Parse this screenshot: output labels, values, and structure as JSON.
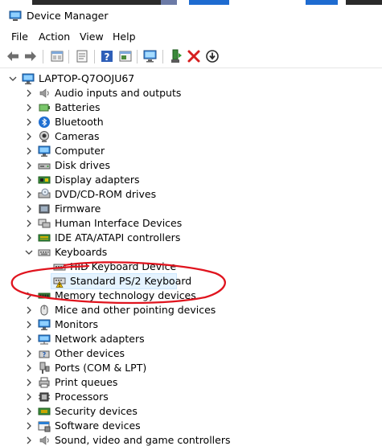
{
  "window": {
    "title": "Device Manager"
  },
  "menu": [
    {
      "label": "File"
    },
    {
      "label": "Action"
    },
    {
      "label": "View"
    },
    {
      "label": "Help"
    }
  ],
  "toolbar": {
    "buttons": [
      "back-icon",
      "forward-icon",
      "properties-sheet-icon",
      "show-hidden-icon",
      "help-icon",
      "action-pane-icon",
      "scan-monitor-icon",
      "update-driver-icon",
      "uninstall-icon",
      "disable-device-icon"
    ]
  },
  "tree": {
    "root": "LAPTOP-Q7OOJU67",
    "categories": [
      {
        "label": "Audio inputs and outputs",
        "icon": "speaker-icon",
        "expanded": false
      },
      {
        "label": "Batteries",
        "icon": "battery-icon",
        "expanded": false
      },
      {
        "label": "Bluetooth",
        "icon": "bluetooth-icon",
        "expanded": false
      },
      {
        "label": "Cameras",
        "icon": "camera-icon",
        "expanded": false
      },
      {
        "label": "Computer",
        "icon": "computer-icon",
        "expanded": false
      },
      {
        "label": "Disk drives",
        "icon": "disk-drive-icon",
        "expanded": false
      },
      {
        "label": "Display adapters",
        "icon": "display-adapter-icon",
        "expanded": false
      },
      {
        "label": "DVD/CD-ROM drives",
        "icon": "dvd-drive-icon",
        "expanded": false
      },
      {
        "label": "Firmware",
        "icon": "firmware-icon",
        "expanded": false
      },
      {
        "label": "Human Interface Devices",
        "icon": "hid-icon",
        "expanded": false
      },
      {
        "label": "IDE ATA/ATAPI controllers",
        "icon": "ide-controller-icon",
        "expanded": false
      },
      {
        "label": "Keyboards",
        "icon": "keyboard-icon",
        "expanded": true,
        "children": [
          {
            "label": "HID Keyboard Device",
            "icon": "keyboard-icon",
            "warning": false
          },
          {
            "label": "Standard PS/2 Keyboard",
            "icon": "keyboard-warning-icon",
            "warning": true
          }
        ]
      },
      {
        "label": "Memory technology devices",
        "icon": "memory-icon",
        "expanded": false
      },
      {
        "label": "Mice and other pointing devices",
        "icon": "mouse-icon",
        "expanded": false
      },
      {
        "label": "Monitors",
        "icon": "monitor-icon",
        "expanded": false
      },
      {
        "label": "Network adapters",
        "icon": "network-adapter-icon",
        "expanded": false
      },
      {
        "label": "Other devices",
        "icon": "other-devices-icon",
        "expanded": false
      },
      {
        "label": "Ports (COM & LPT)",
        "icon": "port-icon",
        "expanded": false
      },
      {
        "label": "Print queues",
        "icon": "printer-icon",
        "expanded": false
      },
      {
        "label": "Processors",
        "icon": "processor-icon",
        "expanded": false
      },
      {
        "label": "Security devices",
        "icon": "security-device-icon",
        "expanded": false
      },
      {
        "label": "Software devices",
        "icon": "software-device-icon",
        "expanded": false
      },
      {
        "label": "Sound, video and game controllers",
        "icon": "sound-controller-icon",
        "expanded": false
      }
    ]
  },
  "colors": {
    "annotation": "#e0141e",
    "warning": "#f2c200",
    "accent": "#1a6fd1"
  }
}
